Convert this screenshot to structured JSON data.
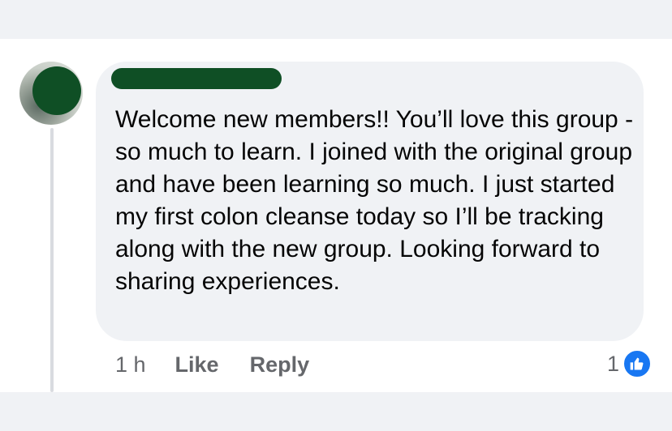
{
  "comment": {
    "author": "",
    "text": "Welcome new members!!  You’ll love this group - so much to learn.  I joined with the original group and have been learning so much.  I just started my first colon cleanse today so I’ll be tracking along with the new group. Looking forward to sharing experiences.",
    "time": "1 h",
    "like_label": "Like",
    "reply_label": "Reply",
    "reaction_count": "1",
    "reaction_icon": "thumbs-up-icon",
    "colors": {
      "bubble": "#f0f2f5",
      "like_blue": "#1877f2",
      "redaction": "#0f4f25",
      "meta_text": "#65676b"
    }
  }
}
